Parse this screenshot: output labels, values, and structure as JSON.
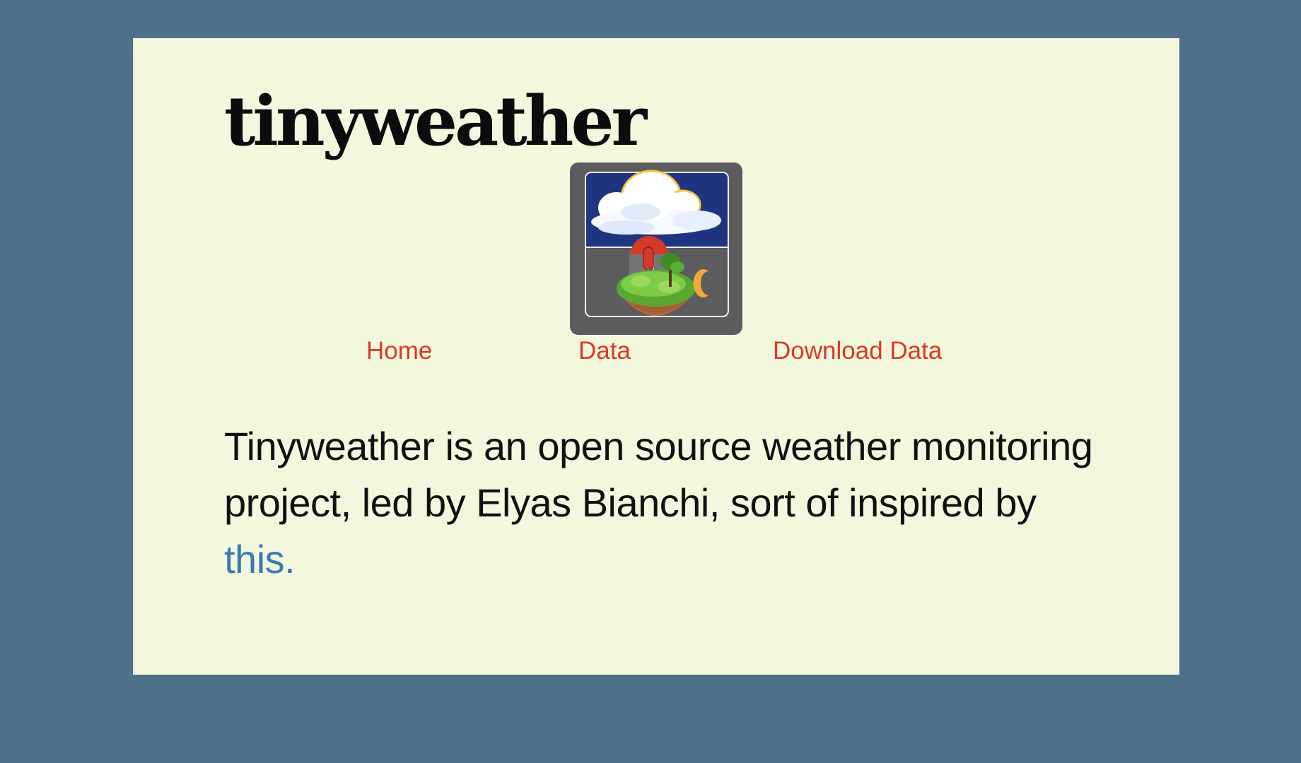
{
  "site": {
    "title": "tinyweather"
  },
  "logo": {
    "icon": "weather-station-island-icon"
  },
  "nav": {
    "items": [
      {
        "label": "Home"
      },
      {
        "label": "Data"
      },
      {
        "label": "Download Data"
      }
    ]
  },
  "intro": {
    "text": "Tinyweather is an open source weather monitoring project, led by Elyas Bianchi, sort of inspired by ",
    "link_label": "this."
  },
  "colors": {
    "background": "#4e7089",
    "card": "#f3f7de",
    "nav_link": "#d93a25",
    "body_link": "#3a7ab3",
    "text": "#111111"
  }
}
